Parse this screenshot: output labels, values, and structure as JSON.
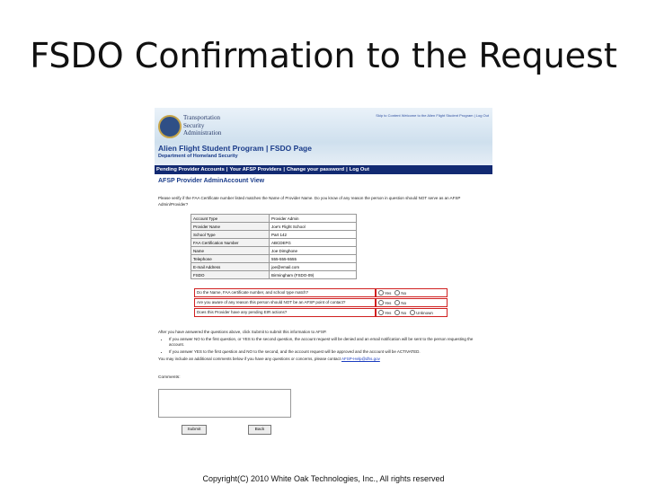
{
  "slide": {
    "title": "FSDO Confirmation to the Request",
    "copyright": "Copyright(C) 2010 White Oak Technologies, Inc., All rights reserved"
  },
  "header": {
    "agency_lines": [
      "Transportation",
      "Security",
      "Administration"
    ],
    "top_link": "Skip to Content Welcome to the Alien Flight Student Program | Log Out",
    "program_title": "Alien Flight Student Program | FSDO Page",
    "program_subtitle": "Department of Homeland Security",
    "colors": {
      "nav_bg": "#122a72",
      "title_blue": "#1a3c8a"
    }
  },
  "nav": {
    "items": [
      "Pending Provider Accounts",
      "Your AFSP Providers",
      "Change your password",
      "Log Out"
    ],
    "separator": "|"
  },
  "page": {
    "heading": "AFSP Provider AdminAccount View",
    "intro": "Please verify if the FAA Certificate number listed matches the Name of Provider Name. Do you know of any reason the person in question should NOT serve as an AFSP Admin/Provider?"
  },
  "info_table": [
    {
      "key": "Account Type",
      "value": "Provider Admin"
    },
    {
      "key": "Provider Name",
      "value": "Joe's Flight School"
    },
    {
      "key": "School Type",
      "value": "Part 142"
    },
    {
      "key": "FAA Certification Number",
      "value": "ABCDEFG"
    },
    {
      "key": "Name",
      "value": "Joe Dimghone"
    },
    {
      "key": "Telephone",
      "value": "555-555-5555"
    },
    {
      "key": "E-mail Address",
      "value": "joe@email.com"
    },
    {
      "key": "FSDO",
      "value": "Birmingham (FSDO-09)"
    }
  ],
  "questions": [
    {
      "text": "Do the Name, FAA certificate number, and school type match?",
      "options": [
        "Yes",
        "No"
      ]
    },
    {
      "text": "Are you aware of any reason this person should NOT be an AFSP point of contact?",
      "options": [
        "Yes",
        "No"
      ]
    },
    {
      "text": "Does this Provider have any pending EIR actions?",
      "options": [
        "Yes",
        "No",
        "Unknown"
      ]
    }
  ],
  "instructions": {
    "lead": "After you have answered the questions above, click Submit to submit this information to AFSP.",
    "bullets": [
      "If you answer NO to the first question, or YES to the second question, the account request will be denied and an email notification will be sent to the person requesting the account.",
      "If you answer YES to the first question and NO to the second, and the account request will be approved and the account will be ACTIVATED."
    ],
    "contact_text": "You may include an additional comments below if you have any questions or concerns, please contact",
    "contact_link": "AFSP-Help@dhs.gov"
  },
  "form": {
    "comments_label": "Comments:",
    "comments_value": "",
    "submit_label": "Submit",
    "back_label": "Back"
  }
}
